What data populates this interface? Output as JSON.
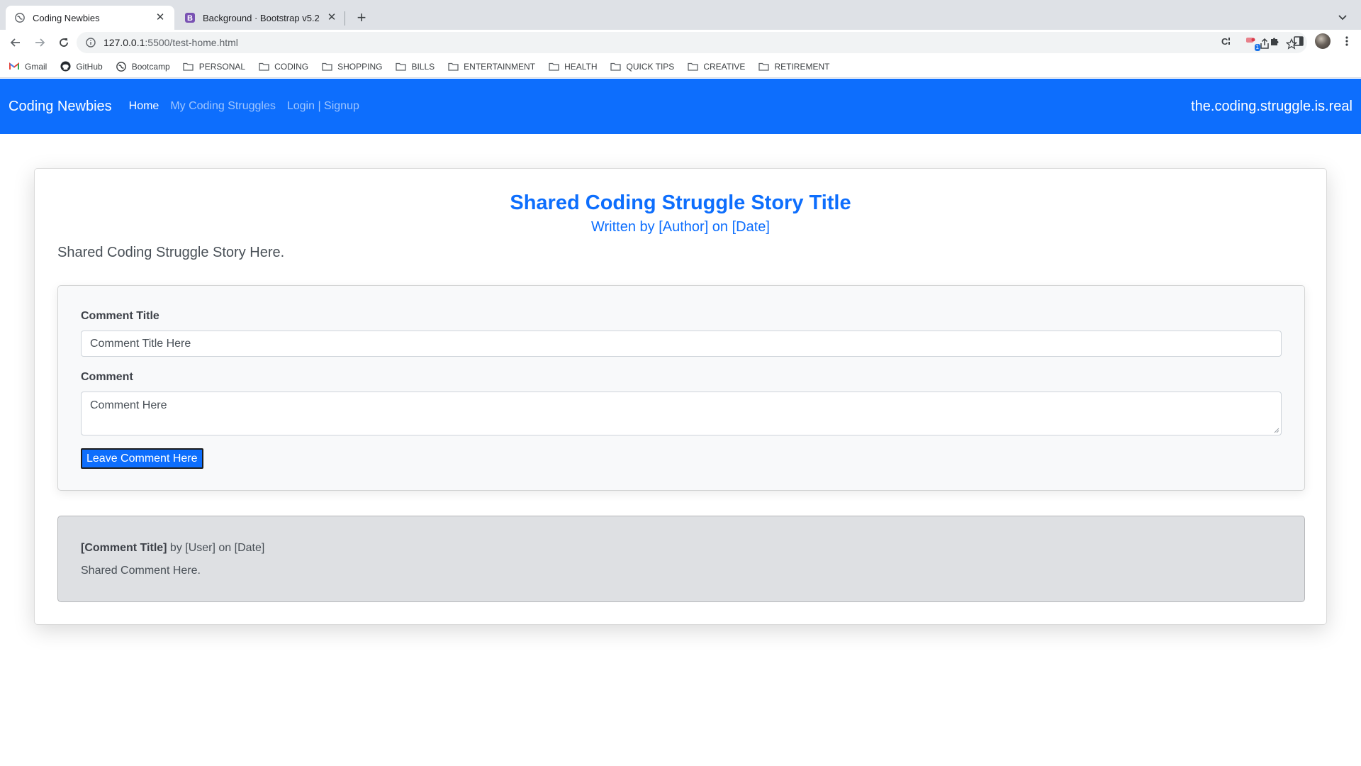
{
  "browser": {
    "tabs": [
      {
        "title": "Coding Newbies",
        "favicon": "globe-icon",
        "active": true
      },
      {
        "title": "Background · Bootstrap v5.2",
        "favicon": "bootstrap-icon",
        "active": false
      }
    ],
    "url_host": "127.0.0.1",
    "url_path": ":5500/test-home.html",
    "extension_badge": "1",
    "bookmarks": [
      {
        "label": "Gmail",
        "icon": "gmail-icon"
      },
      {
        "label": "GitHub",
        "icon": "github-icon"
      },
      {
        "label": "Bootcamp",
        "icon": "globe-icon"
      },
      {
        "label": "PERSONAL",
        "icon": "folder-icon"
      },
      {
        "label": "CODING",
        "icon": "folder-icon"
      },
      {
        "label": "SHOPPING",
        "icon": "folder-icon"
      },
      {
        "label": "BILLS",
        "icon": "folder-icon"
      },
      {
        "label": "ENTERTAINMENT",
        "icon": "folder-icon"
      },
      {
        "label": "HEALTH",
        "icon": "folder-icon"
      },
      {
        "label": "QUICK TIPS",
        "icon": "folder-icon"
      },
      {
        "label": "CREATIVE",
        "icon": "folder-icon"
      },
      {
        "label": "RETIREMENT",
        "icon": "folder-icon"
      }
    ]
  },
  "navbar": {
    "brand": "Coding Newbies",
    "links": [
      "Home",
      "My Coding Struggles",
      "Login | Signup"
    ],
    "tagline": "the.coding.struggle.is.real",
    "color": "#0d6efd"
  },
  "story": {
    "title": "Shared Coding Struggle Story Title",
    "byline": "Written by [Author] on [Date]",
    "body": "Shared Coding Struggle Story Here."
  },
  "comment_form": {
    "title_label": "Comment Title",
    "title_placeholder": "Comment Title Here",
    "comment_label": "Comment",
    "comment_placeholder": "Comment Here",
    "submit_label": "Leave Comment Here"
  },
  "comment": {
    "title": "[Comment Title]",
    "meta": " by [User] on [Date]",
    "body": "Shared Comment Here."
  }
}
